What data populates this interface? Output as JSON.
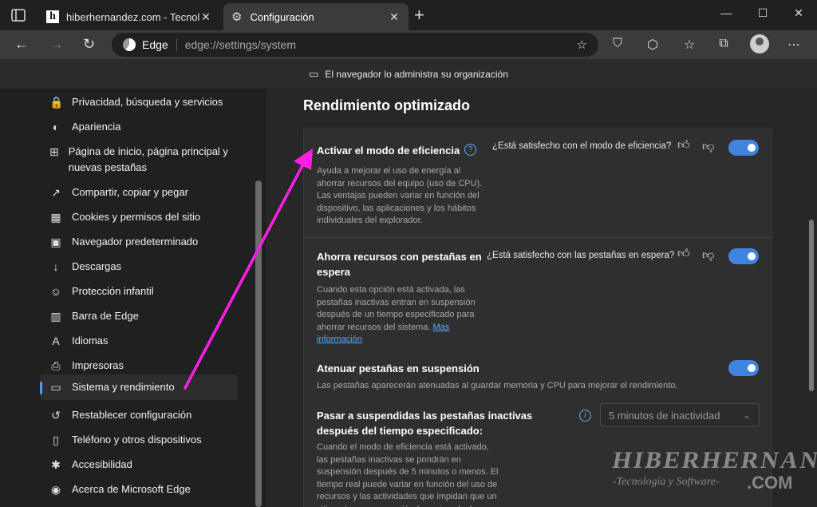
{
  "browser": {
    "tabs": [
      {
        "title": "hiberhernandez.com - Tecnologi",
        "close": "✕"
      },
      {
        "title": "Configuración",
        "close": "✕"
      }
    ],
    "new_tab": "+",
    "window_controls": {
      "minimize": "—",
      "maximize": "☐",
      "close": "✕"
    },
    "address": {
      "edge_label": "Edge",
      "url": "edge://settings/system"
    },
    "managed_banner": "El navegador lo administra su organización"
  },
  "sidebar": {
    "items": [
      {
        "label": "Privacidad, búsqueda y servicios",
        "icon": "lock-icon",
        "glyph": "🔒"
      },
      {
        "label": "Apariencia",
        "icon": "palette-icon",
        "glyph": "◐"
      },
      {
        "label": "Página de inicio, página principal y nuevas pestañas",
        "icon": "home-icon",
        "glyph": "⊞"
      },
      {
        "label": "Compartir, copiar y pegar",
        "icon": "share-icon",
        "glyph": "↗"
      },
      {
        "label": "Cookies y permisos del sitio",
        "icon": "cookie-icon",
        "glyph": "▦"
      },
      {
        "label": "Navegador predeterminado",
        "icon": "browser-icon",
        "glyph": "▣"
      },
      {
        "label": "Descargas",
        "icon": "download-icon",
        "glyph": "↓"
      },
      {
        "label": "Protección infantil",
        "icon": "family-icon",
        "glyph": "☺"
      },
      {
        "label": "Barra de Edge",
        "icon": "sidebar-icon",
        "glyph": "▥"
      },
      {
        "label": "Idiomas",
        "icon": "language-icon",
        "glyph": "A"
      },
      {
        "label": "Impresoras",
        "icon": "printer-icon",
        "glyph": "⎙"
      },
      {
        "label": "Sistema y rendimiento",
        "icon": "laptop-icon",
        "glyph": "▭"
      },
      {
        "label": "Restablecer configuración",
        "icon": "reset-icon",
        "glyph": "↺"
      },
      {
        "label": "Teléfono y otros dispositivos",
        "icon": "phone-icon",
        "glyph": "▯"
      },
      {
        "label": "Accesibilidad",
        "icon": "accessibility-icon",
        "glyph": "✱"
      },
      {
        "label": "Acerca de Microsoft Edge",
        "icon": "edge-icon",
        "glyph": "◉"
      }
    ]
  },
  "main": {
    "title": "Rendimiento optimizado",
    "efficiency": {
      "title": "Activar el modo de eficiencia",
      "desc": "Ayuda a mejorar el uso de energía al ahorrar recursos del equipo (uso de CPU). Las ventajas pueden variar en función del dispositivo, las aplicaciones y los hábitos individuales del explorador.",
      "feedback": "¿Está satisfecho con el modo de eficiencia?",
      "enabled": true
    },
    "sleeping_tabs": {
      "title": "Ahorra recursos con pestañas en espera",
      "desc": "Cuando esta opción está activada, las pestañas inactivas entran en suspensión después de un tiempo especificado para ahorrar recursos del sistema.",
      "link": "Más información",
      "feedback": "¿Está satisfecho con las pestañas en espera?",
      "enabled": true
    },
    "fade_tabs": {
      "title": "Atenuar pestañas en suspensión",
      "desc": "Las pestañas aparecerán atenuadas al guardar memoria y CPU para mejorar el rendimiento.",
      "enabled": true
    },
    "suspend_after": {
      "title": "Pasar a suspendidas las pestañas inactivas después del tiempo especificado:",
      "desc": "Cuando el modo de eficiencia está activado, las pestañas inactivas se pondrán en suspensión después de 5 minutos o menos. El tiempo real puede variar en función del uso de recursos y las actividades que impidan que un sitio entre en suspensión (por ejemplo, la reproducción de audio).",
      "selected": "5 minutos de inactividad"
    }
  },
  "watermark": {
    "name": "HIBERHERNANDEZ",
    "tagline": "-Tecnología y Software-",
    "domain": ".COM"
  },
  "colors": {
    "accent": "#3f85e0",
    "link": "#5aaaff",
    "annotation_arrow": "#ff1ee8"
  }
}
